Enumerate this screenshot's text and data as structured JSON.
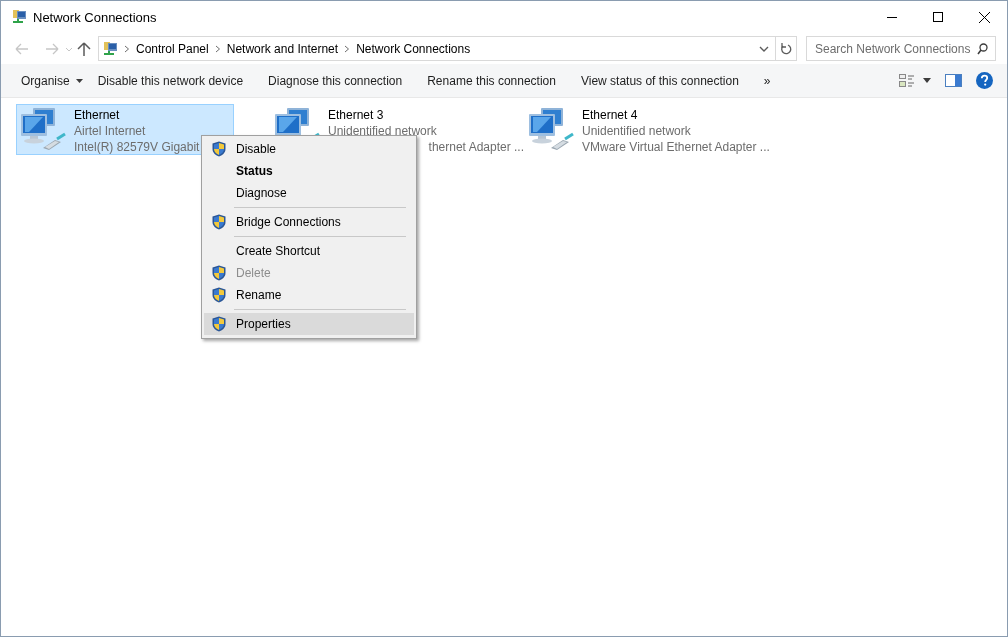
{
  "window": {
    "title": "Network Connections"
  },
  "address_bar": {
    "path": [
      "Control Panel",
      "Network and Internet",
      "Network Connections"
    ]
  },
  "search": {
    "placeholder": "Search Network Connections"
  },
  "toolbar": {
    "commands": [
      {
        "label": "Organise",
        "kind": "menu"
      },
      {
        "label": "Disable this network device",
        "kind": "plain"
      },
      {
        "label": "Diagnose this connection",
        "kind": "plain"
      },
      {
        "label": "Rename this connection",
        "kind": "plain"
      },
      {
        "label": "View status of this connection",
        "kind": "plain"
      }
    ],
    "overflow": "»"
  },
  "connections": [
    {
      "name": "Ethernet",
      "status": "Airtel Internet",
      "adapter": "Intel(R) 82579V Gigabit",
      "selected": true,
      "covered": false
    },
    {
      "name": "Ethernet 3",
      "status": "Unidentified network",
      "adapter": "thernet Adapter ...",
      "selected": false,
      "covered": true
    },
    {
      "name": "Ethernet 4",
      "status": "Unidentified network",
      "adapter": "VMware Virtual Ethernet Adapter ...",
      "selected": false,
      "covered": false
    }
  ],
  "context_menu": {
    "items": [
      {
        "kind": "item",
        "label": "Disable",
        "shield": true,
        "default": false,
        "disabled": false,
        "selected": false
      },
      {
        "kind": "item",
        "label": "Status",
        "shield": false,
        "default": true,
        "disabled": false,
        "selected": false
      },
      {
        "kind": "item",
        "label": "Diagnose",
        "shield": false,
        "default": false,
        "disabled": false,
        "selected": false
      },
      {
        "kind": "separator"
      },
      {
        "kind": "item",
        "label": "Bridge Connections",
        "shield": true,
        "default": false,
        "disabled": false,
        "selected": false
      },
      {
        "kind": "separator"
      },
      {
        "kind": "item",
        "label": "Create Shortcut",
        "shield": false,
        "default": false,
        "disabled": false,
        "selected": false
      },
      {
        "kind": "item",
        "label": "Delete",
        "shield": true,
        "default": false,
        "disabled": true,
        "selected": false
      },
      {
        "kind": "item",
        "label": "Rename",
        "shield": true,
        "default": false,
        "disabled": false,
        "selected": false
      },
      {
        "kind": "separator"
      },
      {
        "kind": "item",
        "label": "Properties",
        "shield": true,
        "default": false,
        "disabled": false,
        "selected": true
      }
    ]
  }
}
